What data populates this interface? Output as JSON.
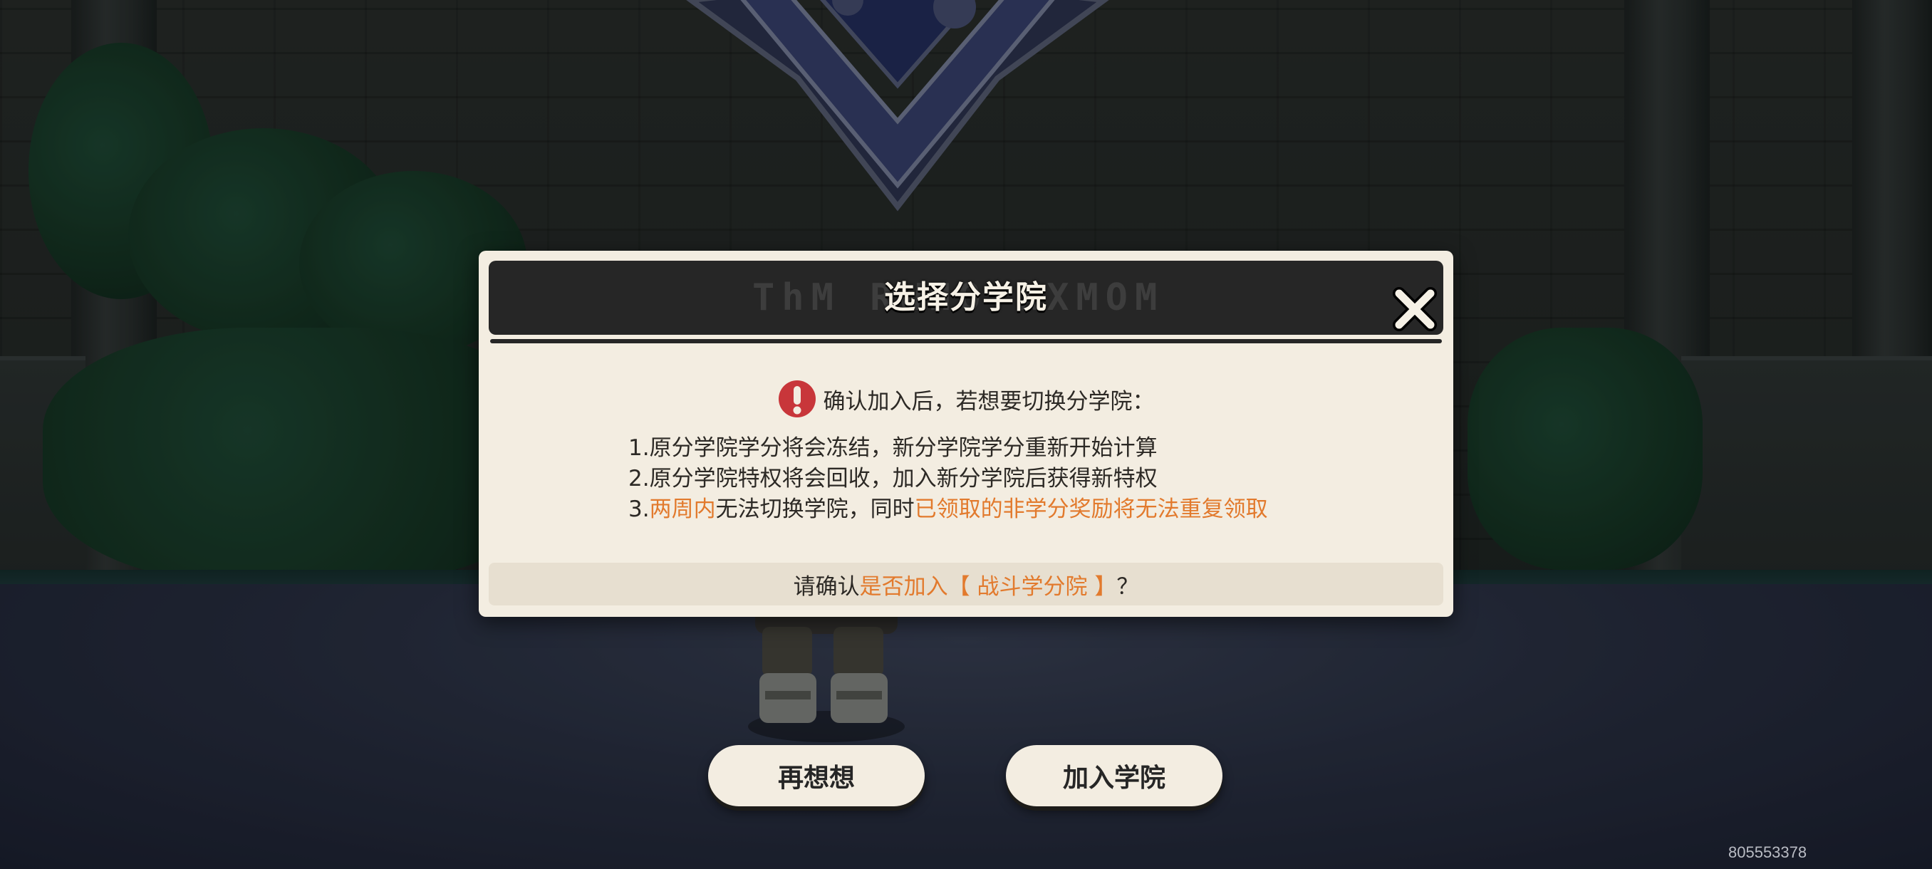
{
  "dialog": {
    "title": "选择分学院",
    "watermark": "ThM RWHO XXMOM",
    "warning": {
      "icon": "exclamation-icon",
      "text": "确认加入后，若想要切换分学院："
    },
    "rules": [
      {
        "text": "1.原分学院学分将会冻结，新分学院学分重新开始计算"
      },
      {
        "text": "2.原分学院特权将会回收，加入新分学院后获得新特权"
      },
      {
        "prefix": "3.",
        "hl1": "两周内",
        "mid": "无法切换学院，同时",
        "hl2": "已领取的非学分奖励将无法重复领取"
      }
    ],
    "confirm": {
      "prefix": "请确认",
      "highlight": "是否加入【 战斗学分院 】",
      "suffix": "？"
    },
    "close_icon": "close-icon"
  },
  "buttons": {
    "cancel_label": "再想想",
    "join_label": "加入学院"
  },
  "uid": "805553378",
  "colors": {
    "accent": "#e27a2d",
    "panel": "#f3ede1",
    "header": "#262626",
    "warning_red": "#c8363a"
  }
}
